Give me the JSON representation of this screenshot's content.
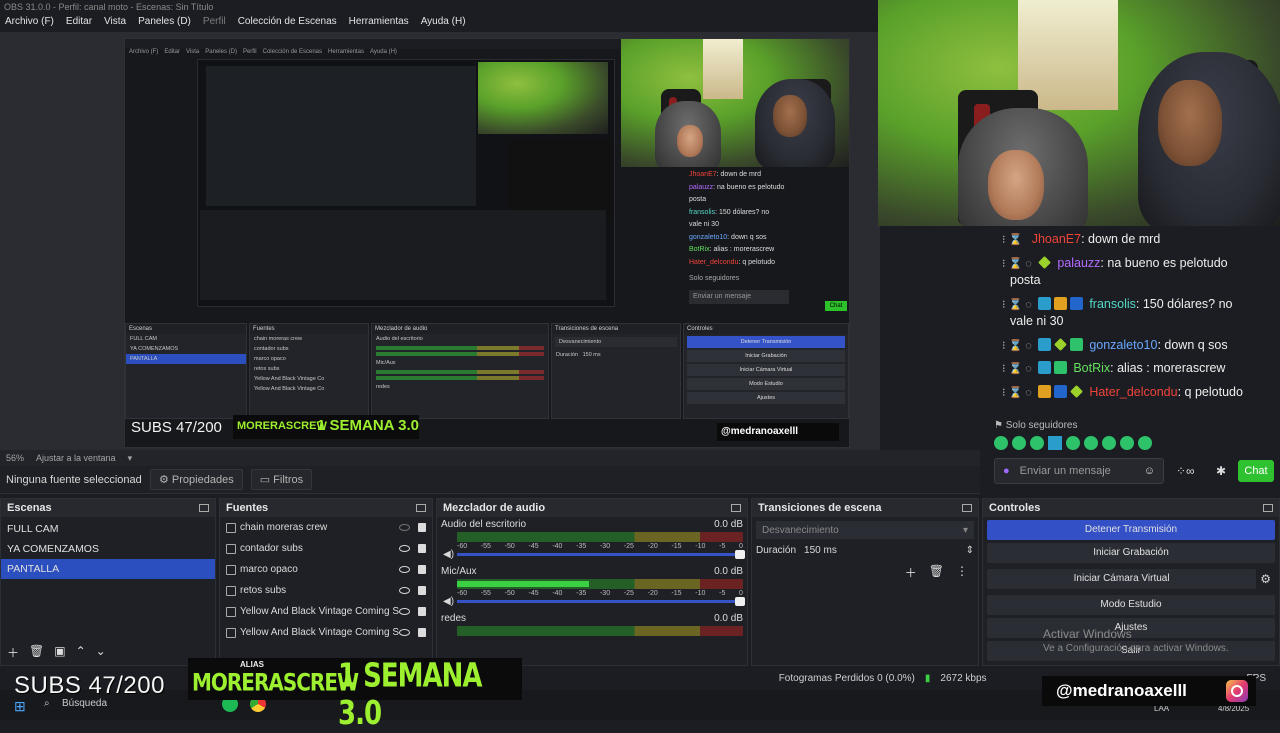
{
  "window": {
    "title": "OBS 31.0.0 - Perfil: canal moto - Escenas: Sin Título"
  },
  "menu": [
    "Archivo (F)",
    "Editar",
    "Vista",
    "Paneles (D)",
    "Perfil",
    "Colección de Escenas",
    "Herramientas",
    "Ayuda (H)"
  ],
  "preview": {
    "nested_menu": [
      "Archivo (F)",
      "Editar",
      "Vista",
      "Paneles (D)",
      "Perfil",
      "Colección de Escenas",
      "Herramientas",
      "Ayuda (H)"
    ],
    "nested_subs": "SUBS 47/200",
    "nested_handle": "@medranoaxelll",
    "nested_alias": "MORERASCREW",
    "nested_semana": "1 SEMANA 3.0"
  },
  "scene_toolbar": {
    "zoom": "56%",
    "fit": "Ajustar a la ventana"
  },
  "props_bar": {
    "selection": "Ninguna fuente seleccionada",
    "properties": "Propiedades",
    "filters": "Filtros"
  },
  "scenes": {
    "title": "Escenas",
    "items": [
      {
        "label": "FULL CAM",
        "selected": false
      },
      {
        "label": "YA COMENZAMOS",
        "selected": false
      },
      {
        "label": "PANTALLA",
        "selected": true
      }
    ]
  },
  "sources": {
    "title": "Fuentes",
    "items": [
      {
        "label": "chain moreras crew",
        "visible": false
      },
      {
        "label": "contador subs",
        "visible": true
      },
      {
        "label": "marco opaco",
        "visible": true
      },
      {
        "label": "retos subs",
        "visible": true
      },
      {
        "label": "Yellow And Black Vintage Coming Soon",
        "visible": true
      },
      {
        "label": "Yellow And Black Vintage Coming Soon",
        "visible": true
      }
    ]
  },
  "mixer": {
    "title": "Mezclador de audio",
    "ticks": [
      "-60",
      "-55",
      "-50",
      "-45",
      "-40",
      "-35",
      "-30",
      "-25",
      "-20",
      "-15",
      "-10",
      "-5",
      "0"
    ],
    "channels": [
      {
        "name": "Audio del escritorio",
        "db": "0.0 dB",
        "level": 0
      },
      {
        "name": "Mic/Aux",
        "db": "0.0 dB",
        "level": 0.46
      },
      {
        "name": "redes",
        "db": "0.0 dB",
        "level": 0
      }
    ]
  },
  "transitions": {
    "title": "Transiciones de escena",
    "selected": "Desvanecimiento",
    "duration_label": "Duración",
    "duration_value": "150 ms"
  },
  "controls": {
    "title": "Controles",
    "buttons": [
      "Detener Transmisión",
      "Iniciar Grabación",
      "Iniciar Cámara Virtual",
      "Modo Estudio",
      "Ajustes",
      "Salir"
    ],
    "watermark_1": "Activar Windows",
    "watermark_2": "Ve a Configuración para activar Windows."
  },
  "status": {
    "dropped": "Fotogramas Perdidos 0 (0.0%)",
    "bitrate": "2672 kbps",
    "fps": "FPS"
  },
  "chat": {
    "messages": [
      {
        "user": "JhoanE7",
        "color": "#f0433a",
        "text": ": down de mrd",
        "badges": [
          "none"
        ]
      },
      {
        "user": "palauzz",
        "color": "#b56bff",
        "text": ": na bueno es pelotudo",
        "cont": "posta",
        "badges": [
          "sparkle"
        ]
      },
      {
        "user": "fransolis",
        "color": "#56d8c8",
        "text": ": 150 dólares? no",
        "cont": "vale ni 30",
        "badges": [
          "vip",
          "crown",
          "blue"
        ]
      },
      {
        "user": "gonzaleto10",
        "color": "#6aa8ff",
        "text": ": down q sos",
        "badges": [
          "vip",
          "sparkle",
          "green"
        ]
      },
      {
        "user": "BotRix",
        "color": "#63e05c",
        "text": ": alias : morerascrew",
        "badges": [
          "vip",
          "green"
        ]
      },
      {
        "user": "Hater_delcondu",
        "color": "#f0433a",
        "text": ": q pelotudo",
        "badges": [
          "crown",
          "blue",
          "sparkle"
        ]
      }
    ],
    "followers_only": "Solo seguidores",
    "input_placeholder": "Enviar un mensaje",
    "chat_button": "Chat"
  },
  "overlay": {
    "subs": "SUBS  47/200",
    "alias": "ALIAS",
    "crew": "MORERASCREW",
    "semana": "1 SEMANA 3.0",
    "handle": "@medranoaxelll"
  },
  "taskbar": {
    "search": "Búsqueda",
    "lang": "LAA",
    "date": "4/8/2025"
  }
}
